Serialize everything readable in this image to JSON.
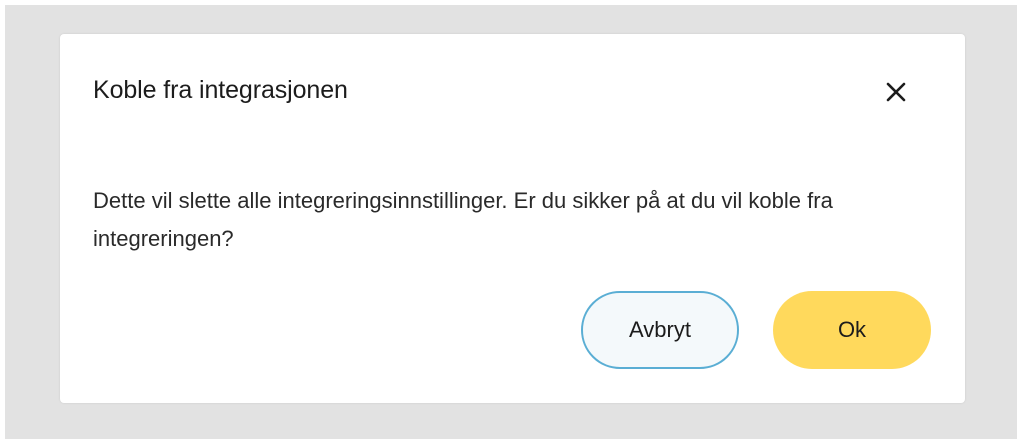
{
  "dialog": {
    "title": "Koble fra integrasjonen",
    "body": "Dette vil slette alle integreringsinnstillinger. Er du sikker på at du vil koble fra integreringen?",
    "close_icon": "close-icon",
    "cancel_label": "Avbryt",
    "ok_label": "Ok"
  },
  "colors": {
    "backdrop": "#e2e2e2",
    "dialog_bg": "#ffffff",
    "cancel_border": "#5aaed4",
    "cancel_bg": "#f4f9fb",
    "ok_bg": "#ffd95c"
  }
}
